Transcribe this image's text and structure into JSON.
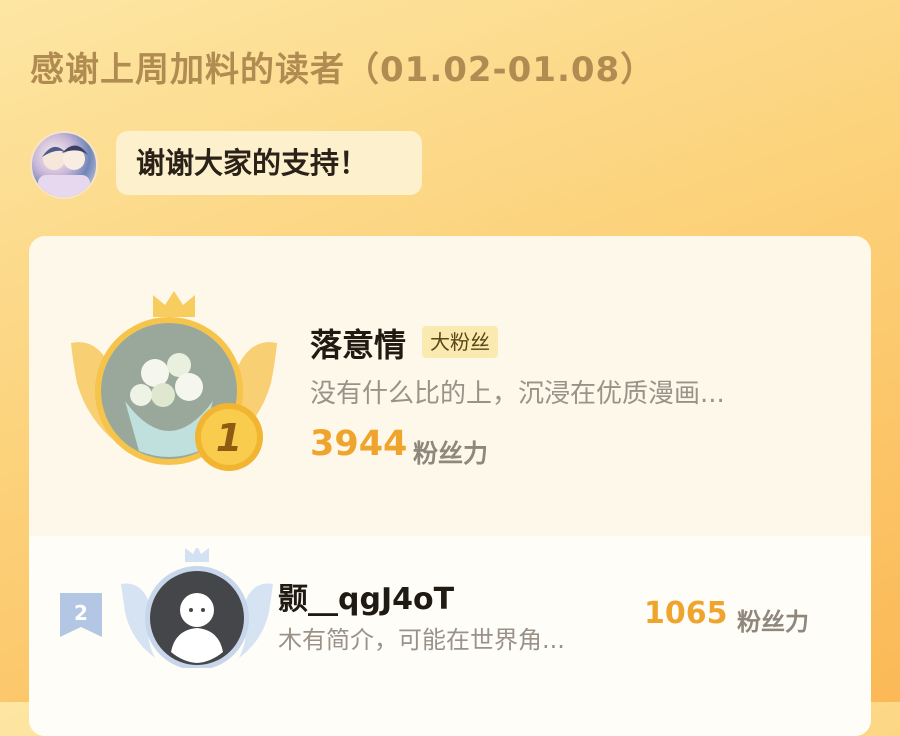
{
  "page": {
    "title": "感谢上周加料的读者（01.02-01.08）"
  },
  "author_message": {
    "text": "谢谢大家的支持！"
  },
  "ranking": [
    {
      "rank": "1",
      "name": "落意情",
      "tag": "大粉丝",
      "description": "没有什么比的上，沉浸在优质漫画...",
      "score": "3944",
      "score_unit": "粉丝力"
    },
    {
      "rank": "2",
      "name": "颢__qgJ4oT",
      "description": "木有简介，可能在世界角...",
      "score": "1065",
      "score_unit": "粉丝力"
    }
  ],
  "colors": {
    "accent": "#efa52d",
    "background": "#fcd27b",
    "title": "#b18c52"
  }
}
